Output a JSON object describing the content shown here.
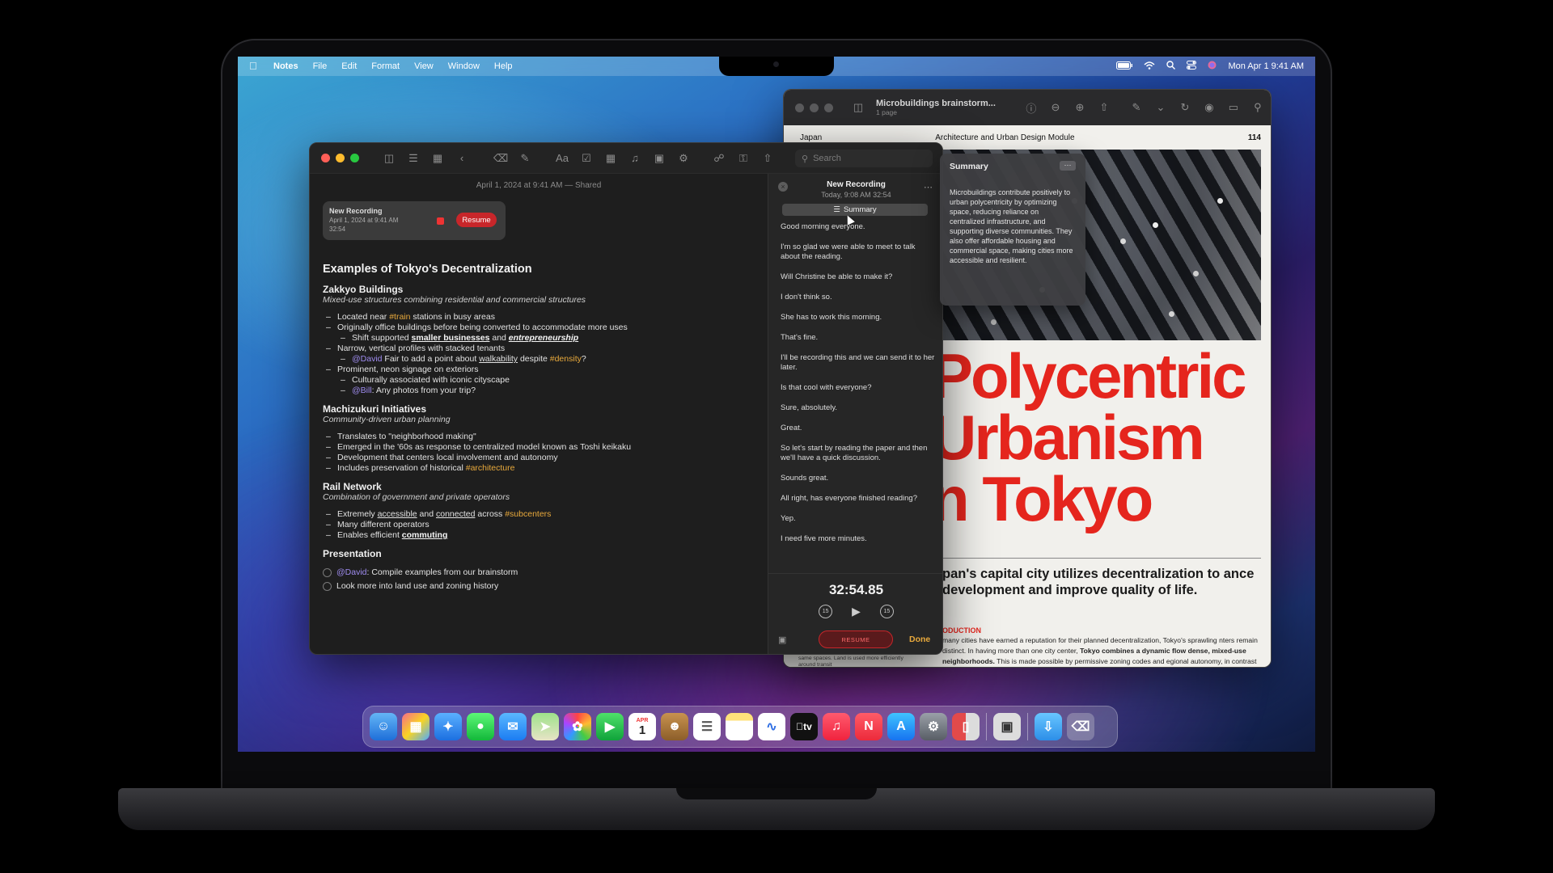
{
  "menubar": {
    "app": "Notes",
    "items": [
      "File",
      "Edit",
      "Format",
      "View",
      "Window",
      "Help"
    ],
    "clock": "Mon Apr 1  9:41 AM"
  },
  "notes_window": {
    "search_placeholder": "Search",
    "note_date": "April 1, 2024 at 9:41 AM — Shared",
    "recording_card": {
      "title": "New Recording",
      "date": "April 1, 2024 at 9:41 AM",
      "duration": "32:54",
      "resume": "Resume"
    },
    "note": {
      "title": "Examples of Tokyo's Decentralization",
      "s1_heading": "Zakkyo Buildings",
      "s1_sub": "Mixed-use structures combining residential and commercial structures",
      "s1_b1_pre": "Located near ",
      "s1_b1_tag": "#train",
      "s1_b1_post": " stations in busy areas",
      "s1_b2": "Originally office buildings before being converted to accommodate more uses",
      "s1_b3_pre": "Shift supported ",
      "s1_b3_link1": "smaller businesses",
      "s1_b3_mid": " and ",
      "s1_b3_link2": "entrepreneurship",
      "s1_b4": "Narrow, vertical profiles with stacked tenants",
      "s1_b5_mention": "@David",
      "s1_b5_pre": " Fair to add a point about ",
      "s1_b5_link": "walkability",
      "s1_b5_mid": " despite ",
      "s1_b5_tag": "#density",
      "s1_b5_post": "?",
      "s1_b6": "Prominent, neon signage on exteriors",
      "s1_b7": "Culturally associated with iconic cityscape",
      "s1_b8_mention": "@Bill",
      "s1_b8_post": ": Any photos from your trip?",
      "s2_heading": "Machizukuri Initiatives",
      "s2_sub": "Community-driven urban planning",
      "s2_b1": "Translates to \"neighborhood making\"",
      "s2_b2": "Emerged in the '60s as response to centralized model known as Toshi keikaku",
      "s2_b3": "Development that centers local involvement and autonomy",
      "s2_b4_pre": "Includes preservation of historical ",
      "s2_b4_tag": "#architecture",
      "s3_heading": "Rail Network",
      "s3_sub": "Combination of government and private operators",
      "s3_b1_pre": "Extremely ",
      "s3_b1_link1": "accessible",
      "s3_b1_mid": " and ",
      "s3_b1_link2": "connected",
      "s3_b1_mid2": " across ",
      "s3_b1_tag": "#subcenters",
      "s3_b2": "Many different operators",
      "s3_b3_pre": "Enables efficient ",
      "s3_b3_link": "commuting",
      "s4_heading": "Presentation",
      "c1_mention": "@David",
      "c1_post": ": Compile examples from our brainstorm",
      "c2": "Look more into land use and zoning history"
    },
    "transcript": {
      "title": "New Recording",
      "subtitle": "Today, 9:08 AM   32:54",
      "summary_button": "Summary",
      "lines": [
        "Good morning everyone.",
        "I'm so glad we were able to meet to talk about the reading.",
        "Will Christine be able to make it?",
        "I don't think so.",
        "She has to work this morning.",
        "That's fine.",
        "I'll be recording this and we can send it to her later.",
        "Is that cool with everyone?",
        "Sure, absolutely.",
        "Great.",
        "So let's start by reading the paper and then we'll have a quick discussion.",
        "Sounds great.",
        "All right, has everyone finished reading?",
        "Yep.",
        "I need five more minutes."
      ],
      "timer": "32:54.85",
      "skip_back": "15",
      "skip_fwd": "15",
      "resume": "RESUME",
      "done": "Done"
    }
  },
  "preview_window": {
    "title": "Microbuildings brainstorm...",
    "subtitle": "1 page",
    "page_left": "Japan",
    "page_mid": "Architecture and Urban Design Module",
    "page_num": "114",
    "headline_1": "Polycentric",
    "headline_2": "Urbanism",
    "headline_3": "n Tokyo",
    "subhead": "pan's capital city utilizes decentralization to ance development and improve quality of life.",
    "intro_label": "ODUCTION",
    "body_pre": "many cities have earned a reputation for their planned decentralization, Tokyo's sprawling nters remain distinct. In having more than one city center, ",
    "body_bold": "Tokyo combines a dynamic flow dense, mixed-use neighborhoods.",
    "body_post": " This is made possible by permissive zoning codes and egional autonomy, in contrast to cities in Europe and elsewhere. Concentrated around transport hubs and connected by over 14 different rail operators, these subcenters result in a distributed balance of population and employment.",
    "left_col": "allowed by Tokyo's zoning ordinance combines residential, commercial, and industrial uses in the same spaces. Land is used more efficiently around transit"
  },
  "summary_popup": {
    "title": "Summary",
    "body": "Microbuildings contribute positively to urban polycentricity by optimizing space, reducing reliance on centralized infrastructure, and supporting diverse communities. They also offer affordable housing and commercial space, making cities more accessible and resilient."
  },
  "dock": {
    "calendar_month": "APR",
    "calendar_day": "1",
    "tv_label": "tv"
  },
  "colors": {
    "accent_tag": "#e8a93c",
    "mention": "#9f8cf0",
    "record_red": "#c8262a",
    "headline_red": "#e5251d"
  }
}
